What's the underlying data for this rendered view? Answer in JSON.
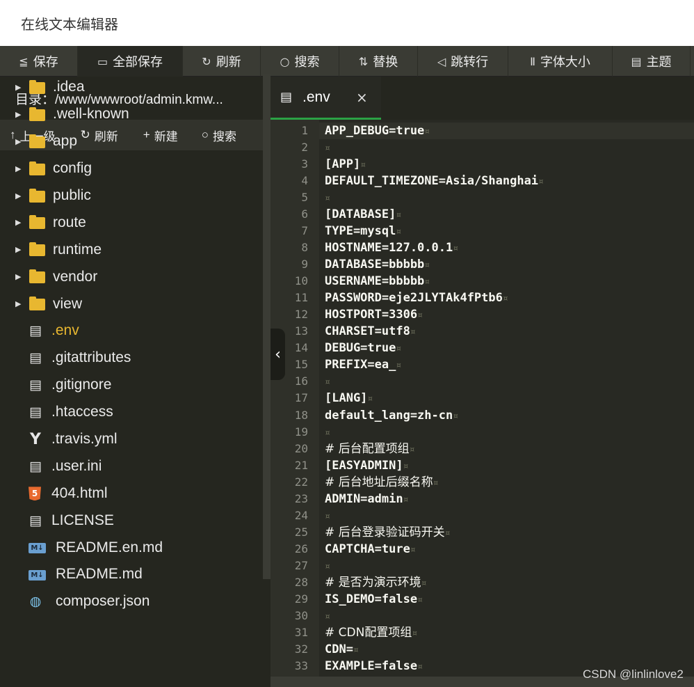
{
  "window": {
    "title": "在线文本编辑器"
  },
  "toolbar": {
    "buttons": [
      {
        "icon": "≦",
        "label": "保存"
      },
      {
        "icon": "▭",
        "label": "全部保存"
      },
      {
        "icon": "↻",
        "label": "刷新"
      },
      {
        "icon": "○",
        "label": "搜索"
      },
      {
        "icon": "⇅",
        "label": "替换"
      },
      {
        "icon": "◁",
        "label": "跳转行"
      },
      {
        "icon": "Ⅱ",
        "label": "字体大小"
      },
      {
        "icon": "▤",
        "label": "主题"
      }
    ]
  },
  "sidebar": {
    "directory": "目录：/www/wwwroot/admin.kmw...",
    "buttons": [
      {
        "icon": "↑",
        "label": "上一级"
      },
      {
        "icon": "↻",
        "label": "刷新"
      },
      {
        "icon": "+",
        "label": "新建"
      },
      {
        "icon": "○",
        "label": "搜索"
      }
    ],
    "folders": [
      ".idea",
      ".well-known",
      "app",
      "config",
      "public",
      "route",
      "runtime",
      "vendor",
      "view"
    ],
    "files": [
      {
        "name": ".env",
        "icon": "doc-icon",
        "selected": true
      },
      {
        "name": ".gitattributes",
        "icon": "doc-icon"
      },
      {
        "name": ".gitignore",
        "icon": "doc-icon"
      },
      {
        "name": ".htaccess",
        "icon": "doc-icon"
      },
      {
        "name": ".travis.yml",
        "icon": "yaml-icon"
      },
      {
        "name": ".user.ini",
        "icon": "doc-icon"
      },
      {
        "name": "404.html",
        "icon": "html5-icon"
      },
      {
        "name": "LICENSE",
        "icon": "doc-icon"
      },
      {
        "name": "README.en.md",
        "icon": "markdown-icon"
      },
      {
        "name": "README.md",
        "icon": "markdown-icon"
      },
      {
        "name": "composer.json",
        "icon": "composer-icon"
      }
    ]
  },
  "tab": {
    "name": ".env",
    "close": "×"
  },
  "editor": {
    "collapse_glyph": "‹",
    "lines": [
      "APP_DEBUG=true",
      "",
      "[APP]",
      "DEFAULT_TIMEZONE=Asia/Shanghai",
      "",
      "[DATABASE]",
      "TYPE=mysql",
      "HOSTNAME=127.0.0.1",
      "DATABASE=bbbbb",
      "USERNAME=bbbbb",
      "PASSWORD=eje2JLYTAk4fPtb6",
      "HOSTPORT=3306",
      "CHARSET=utf8",
      "DEBUG=true",
      "PREFIX=ea_",
      "",
      "[LANG]",
      "default_lang=zh-cn",
      "",
      "# 后台配置项组",
      "[EASYADMIN]",
      "# 后台地址后缀名称",
      "ADMIN=admin",
      "",
      "# 后台登录验证码开关",
      "CAPTCHA=ture",
      "",
      "# 是否为演示环境",
      "IS_DEMO=false",
      "",
      "# CDN配置项组",
      "CDN=",
      "EXAMPLE=false"
    ],
    "line_numbers": [
      "1",
      "2",
      "3",
      "4",
      "5",
      "6",
      "7",
      "8",
      "9",
      "10",
      "11",
      "12",
      "13",
      "14",
      "15",
      "16",
      "17",
      "18",
      "19",
      "20",
      "21",
      "22",
      "23",
      "24",
      "25",
      "26",
      "27",
      "28",
      "29",
      "30",
      "31",
      "32",
      "33"
    ]
  },
  "watermark": "CSDN @linlinlove2"
}
